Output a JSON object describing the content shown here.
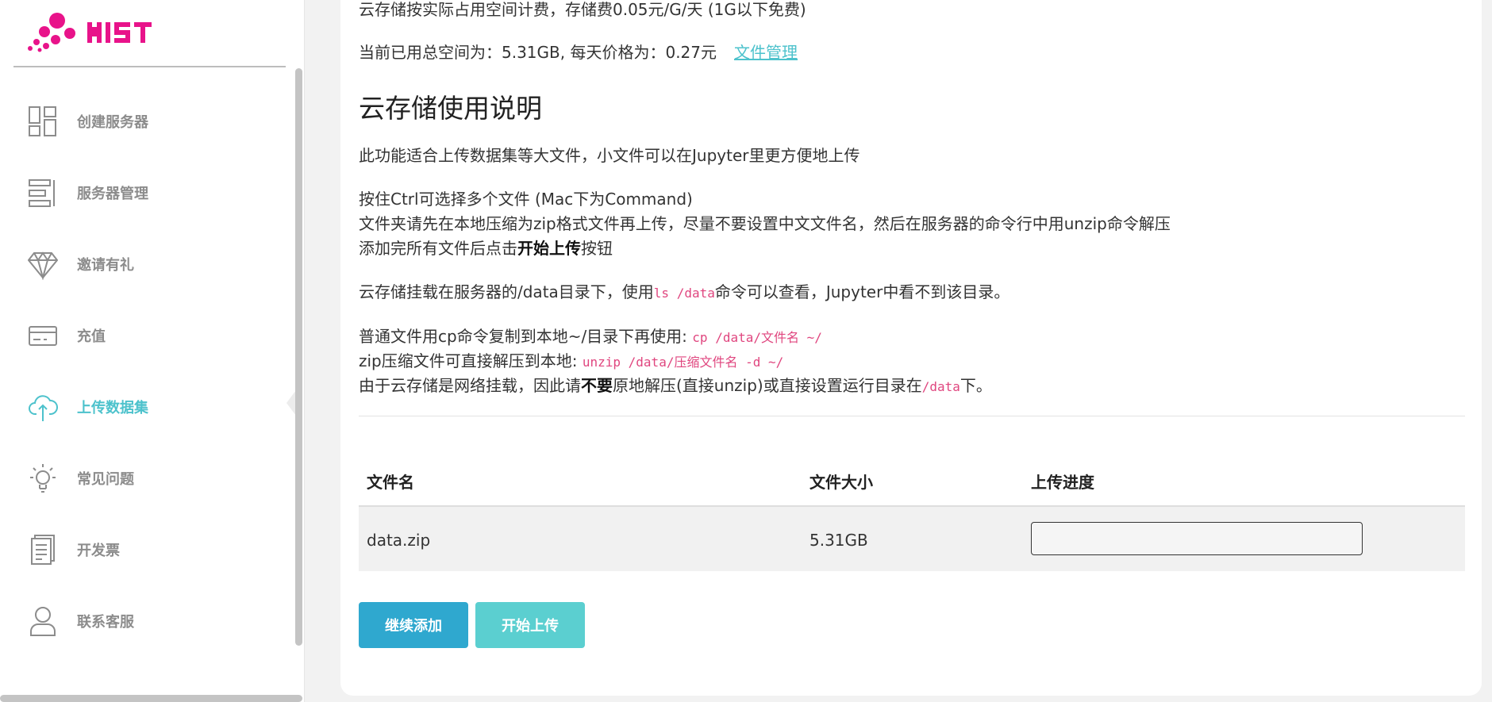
{
  "brand": {
    "logo_text": "MIST",
    "logo_color": "#e8138a"
  },
  "sidebar": {
    "items": [
      {
        "label": "创建服务器",
        "icon": "dashboard-icon",
        "active": false
      },
      {
        "label": "服务器管理",
        "icon": "server-list-icon",
        "active": false
      },
      {
        "label": "邀请有礼",
        "icon": "diamond-icon",
        "active": false
      },
      {
        "label": "充值",
        "icon": "credit-card-icon",
        "active": false
      },
      {
        "label": "上传数据集",
        "icon": "cloud-upload-icon",
        "active": true
      },
      {
        "label": "常见问题",
        "icon": "lightbulb-icon",
        "active": false
      },
      {
        "label": "开发票",
        "icon": "invoice-icon",
        "active": false
      },
      {
        "label": "联系客服",
        "icon": "user-icon",
        "active": false
      }
    ],
    "active_color": "#4dc2cc",
    "inactive_color": "#8c8c8c"
  },
  "main": {
    "billing_note": "云存储按实际占用空间计费，存储费0.05元/G/天 (1G以下免费)",
    "usage_prefix": "当前已用总空间为：5.31GB, 每天价格为：0.27元",
    "file_manage_link": "文件管理",
    "heading": "云存储使用说明",
    "intro": "此功能适合上传数据集等大文件，小文件可以在Jupyter里更方便地上传",
    "tip_ctrl": "按住Ctrl可选择多个文件 (Mac下为Command)",
    "tip_zip": "文件夹请先在本地压缩为zip格式文件再上传，尽量不要设置中文文件名，然后在服务器的命令行中用unzip命令解压",
    "tip_finish_pre": "添加完所有文件后点击",
    "tip_finish_bold": "开始上传",
    "tip_finish_post": "按钮",
    "mount_pre": "云存储挂载在服务器的/data目录下，使用",
    "mount_code": "ls /data",
    "mount_post": "命令可以查看，Jupyter中看不到该目录。",
    "cp_pre": "普通文件用cp命令复制到本地~/目录下再使用: ",
    "cp_code": "cp /data/文件名 ~/",
    "unzip_pre": "zip压缩文件可直接解压到本地: ",
    "unzip_code": "unzip /data/压缩文件名 -d ~/",
    "warn_pre": "由于云存储是网络挂载，因此请",
    "warn_bold": "不要",
    "warn_mid": "原地解压(直接unzip)或直接设置运行目录在",
    "warn_code": "/data",
    "warn_post": "下。"
  },
  "table": {
    "headers": [
      "文件名",
      "文件大小",
      "上传进度"
    ],
    "rows": [
      {
        "name": "data.zip",
        "size": "5.31GB",
        "progress": 0
      }
    ]
  },
  "buttons": {
    "continue_add": "继续添加",
    "start_upload": "开始上传",
    "continue_color": "#2fa8cf",
    "start_color": "#5bcfd0"
  }
}
